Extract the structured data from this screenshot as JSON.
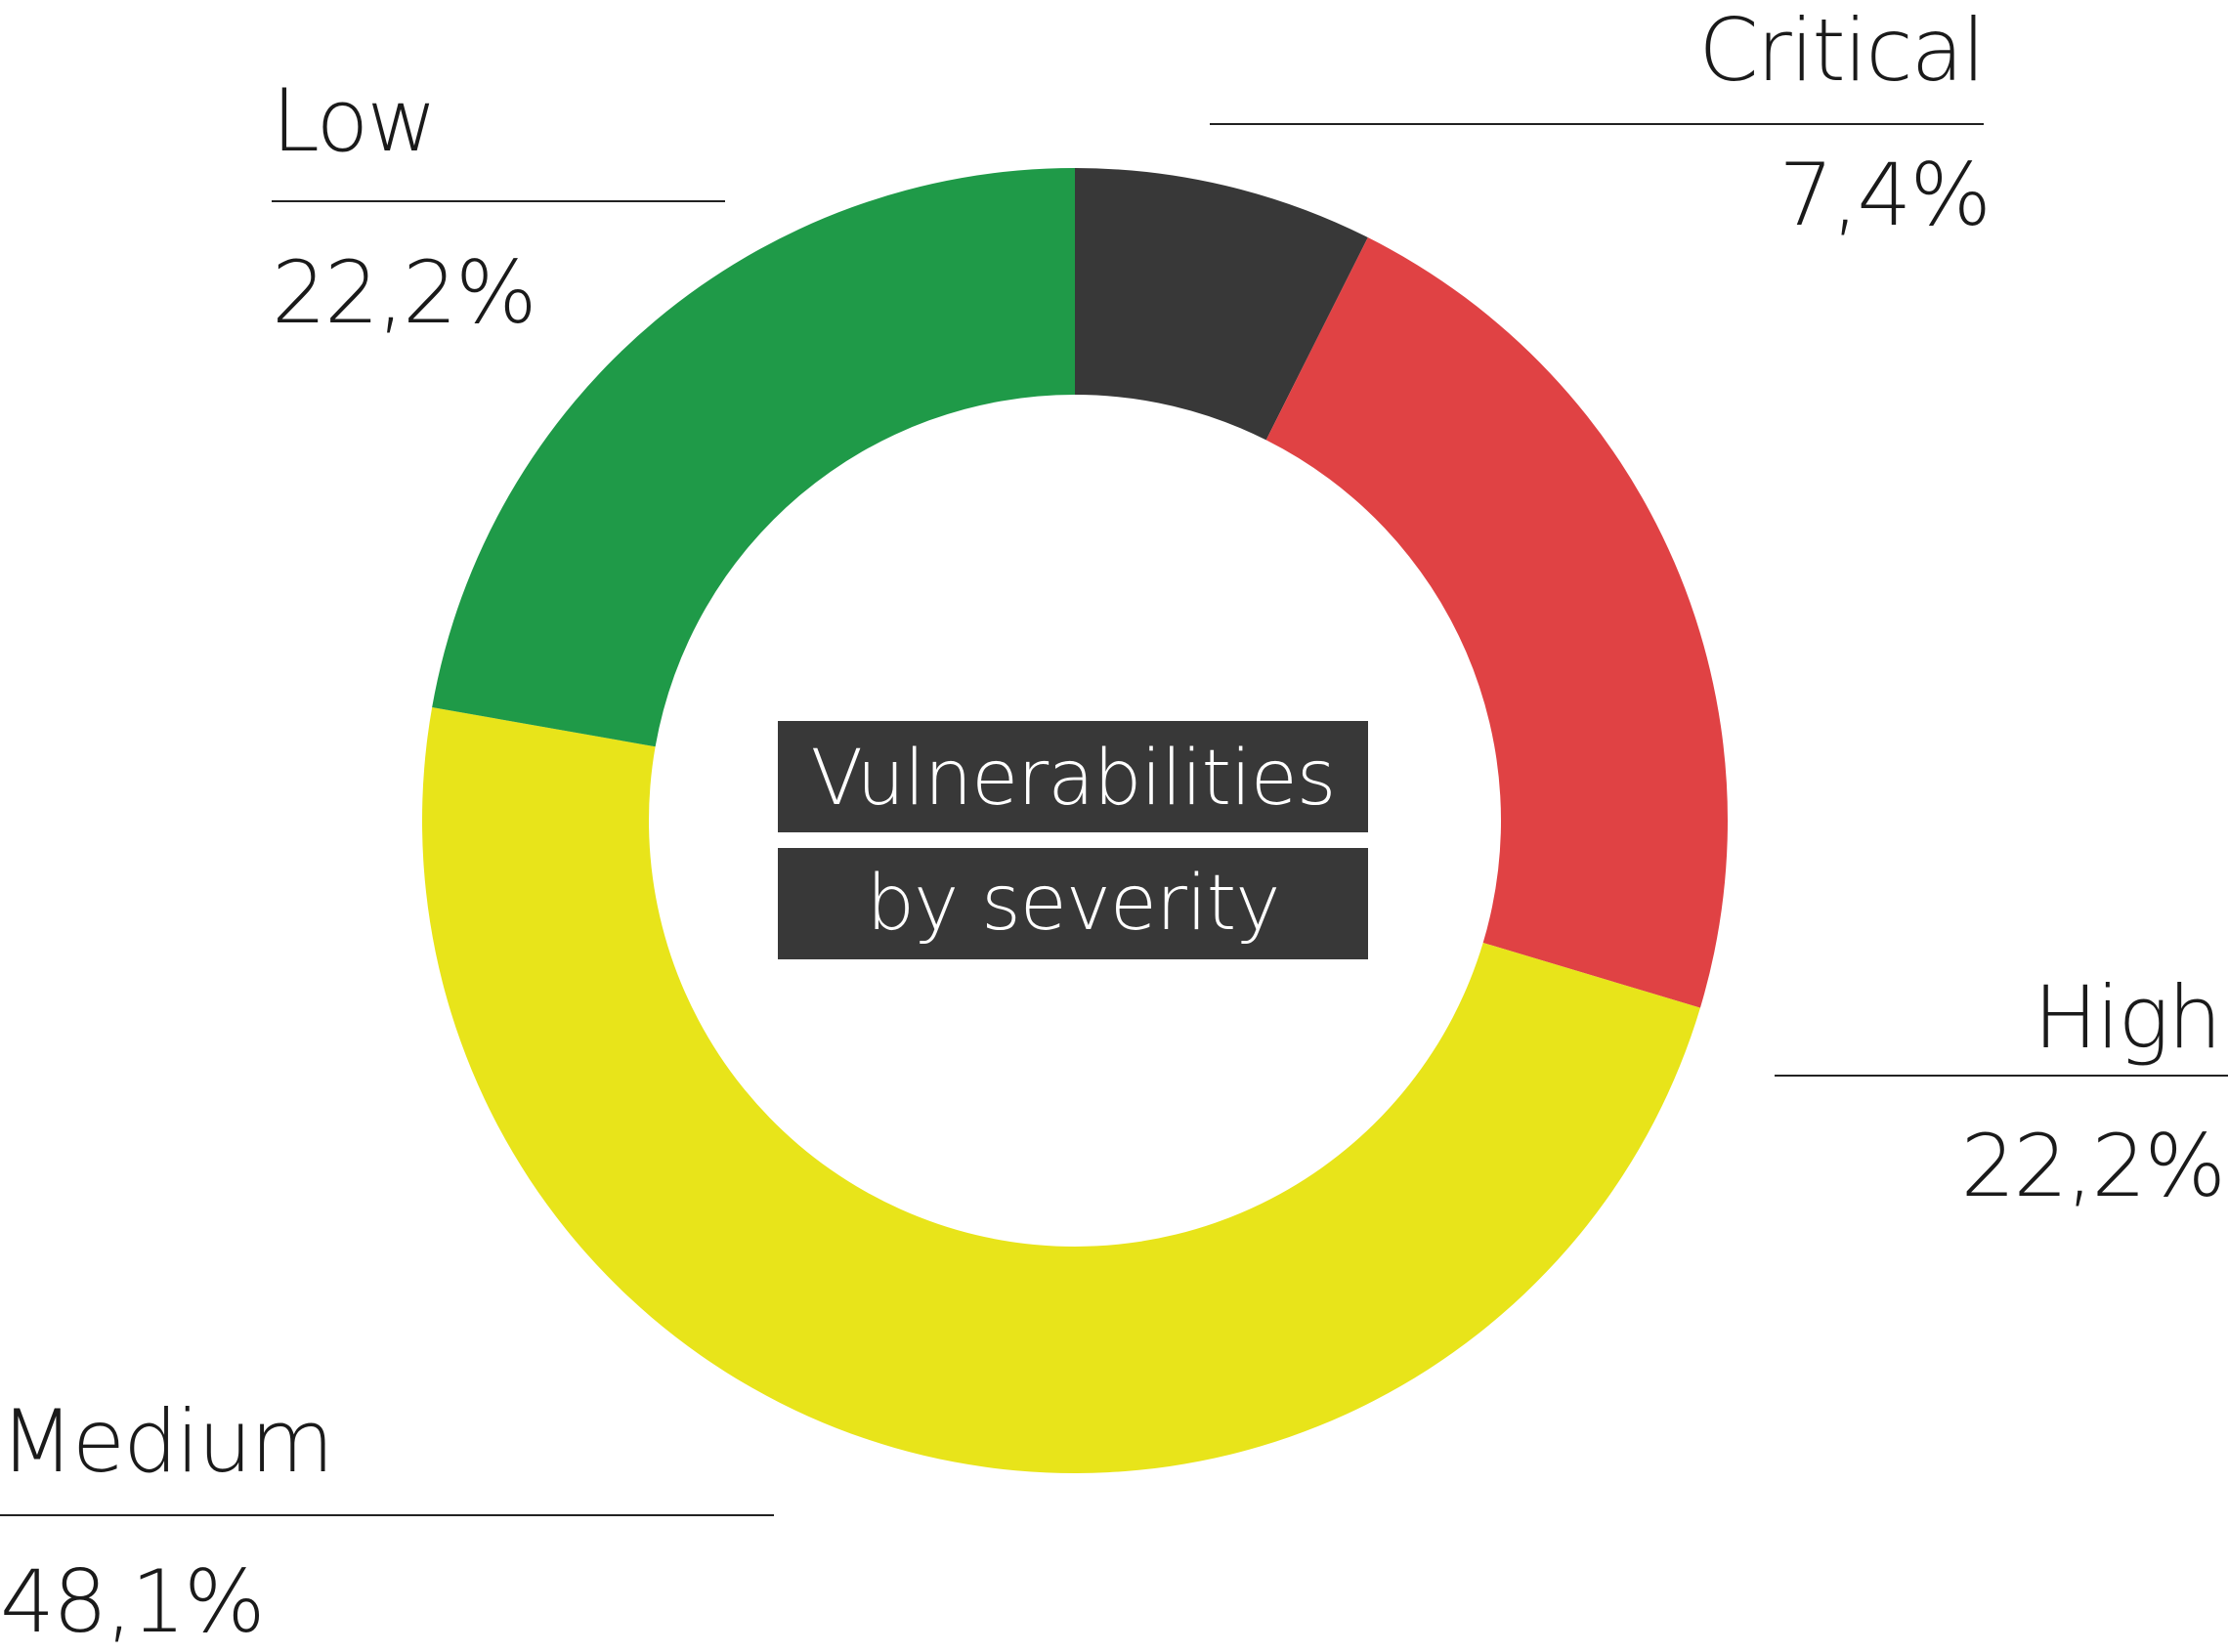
{
  "chart_data": {
    "type": "pie",
    "variant": "donut",
    "title": "Vulnerabilities by severity",
    "title_lines": [
      "Vulnerabilities",
      "by severity"
    ],
    "slices": [
      {
        "name": "Critical",
        "value": 7.4,
        "label": "7,4%",
        "color": "#383838"
      },
      {
        "name": "High",
        "value": 22.2,
        "label": "22,2%",
        "color": "#e04244"
      },
      {
        "name": "Medium",
        "value": 48.1,
        "label": "48,1%",
        "color": "#e8e41a"
      },
      {
        "name": "Low",
        "value": 22.2,
        "label": "22,2%",
        "color": "#1f9a48"
      }
    ],
    "start_angle": "12 o'clock",
    "direction": "clockwise",
    "legend": "none",
    "label_placement": "outside with underline rules"
  }
}
